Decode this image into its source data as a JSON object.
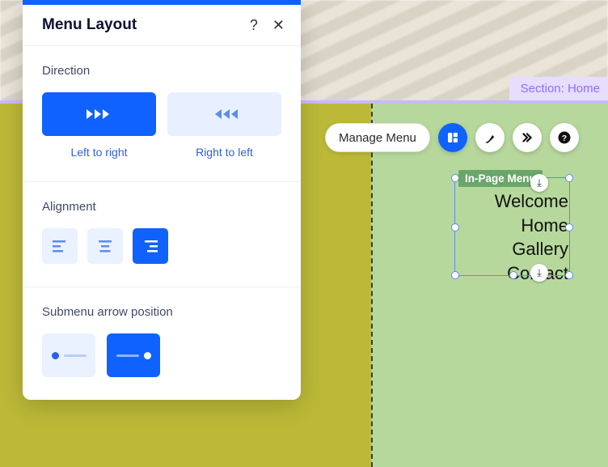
{
  "section_tag": "Section: Home",
  "toolbar": {
    "manage": "Manage Menu"
  },
  "menu_tag": "In-Page Menu",
  "menu_items": [
    "Welcome",
    "Home",
    "Gallery",
    "Contact"
  ],
  "panel": {
    "title": "Menu Layout",
    "direction_label": "Direction",
    "ltr": "Left to right",
    "rtl": "Right to left",
    "alignment_label": "Alignment",
    "submenu_label": "Submenu arrow position"
  }
}
